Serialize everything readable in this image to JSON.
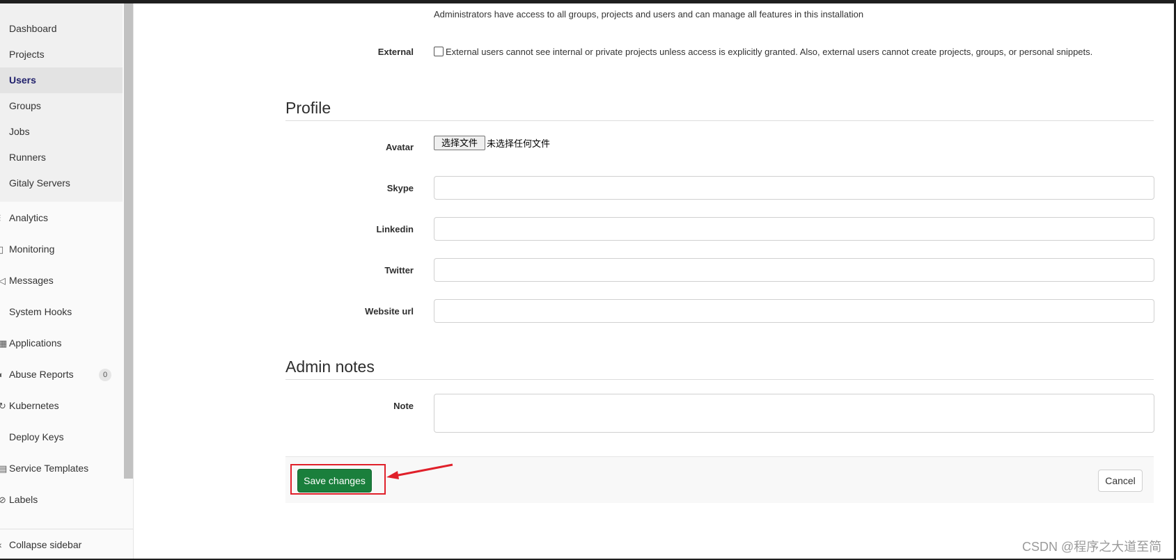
{
  "sidebar": {
    "sub_items": [
      {
        "label": "Dashboard"
      },
      {
        "label": "Projects"
      },
      {
        "label": "Users"
      },
      {
        "label": "Groups"
      },
      {
        "label": "Jobs"
      },
      {
        "label": "Runners"
      },
      {
        "label": "Gitaly Servers"
      }
    ],
    "items": [
      {
        "label": "Analytics",
        "icon": "analytics-icon"
      },
      {
        "label": "Monitoring",
        "icon": "monitoring-icon"
      },
      {
        "label": "Messages",
        "icon": "messages-icon"
      },
      {
        "label": "System Hooks",
        "icon": "hook-icon"
      },
      {
        "label": "Applications",
        "icon": "applications-icon"
      },
      {
        "label": "Abuse Reports",
        "icon": "abuse-icon",
        "badge": "0"
      },
      {
        "label": "Kubernetes",
        "icon": "kubernetes-icon"
      },
      {
        "label": "Deploy Keys",
        "icon": "key-icon"
      },
      {
        "label": "Service Templates",
        "icon": "template-icon"
      },
      {
        "label": "Labels",
        "icon": "label-icon"
      }
    ],
    "collapse_label": "Collapse sidebar"
  },
  "access": {
    "admin_description": "Administrators have access to all groups, projects and users and can manage all features in this installation",
    "external_label": "External",
    "external_description": "External users cannot see internal or private projects unless access is explicitly granted. Also, external users cannot create projects, groups, or personal snippets."
  },
  "profile": {
    "title": "Profile",
    "avatar_label": "Avatar",
    "file_button": "选择文件",
    "file_status": "未选择任何文件",
    "skype_label": "Skype",
    "skype_value": "",
    "linkedin_label": "Linkedin",
    "linkedin_value": "",
    "twitter_label": "Twitter",
    "twitter_value": "",
    "website_label": "Website url",
    "website_value": ""
  },
  "admin_notes": {
    "title": "Admin notes",
    "note_label": "Note",
    "note_value": ""
  },
  "actions": {
    "save_label": "Save changes",
    "cancel_label": "Cancel"
  },
  "watermark": "CSDN @程序之大道至简",
  "colors": {
    "save_button": "#1a7f3c",
    "highlight": "#e0202a",
    "active_nav": "#1f1f6b"
  }
}
